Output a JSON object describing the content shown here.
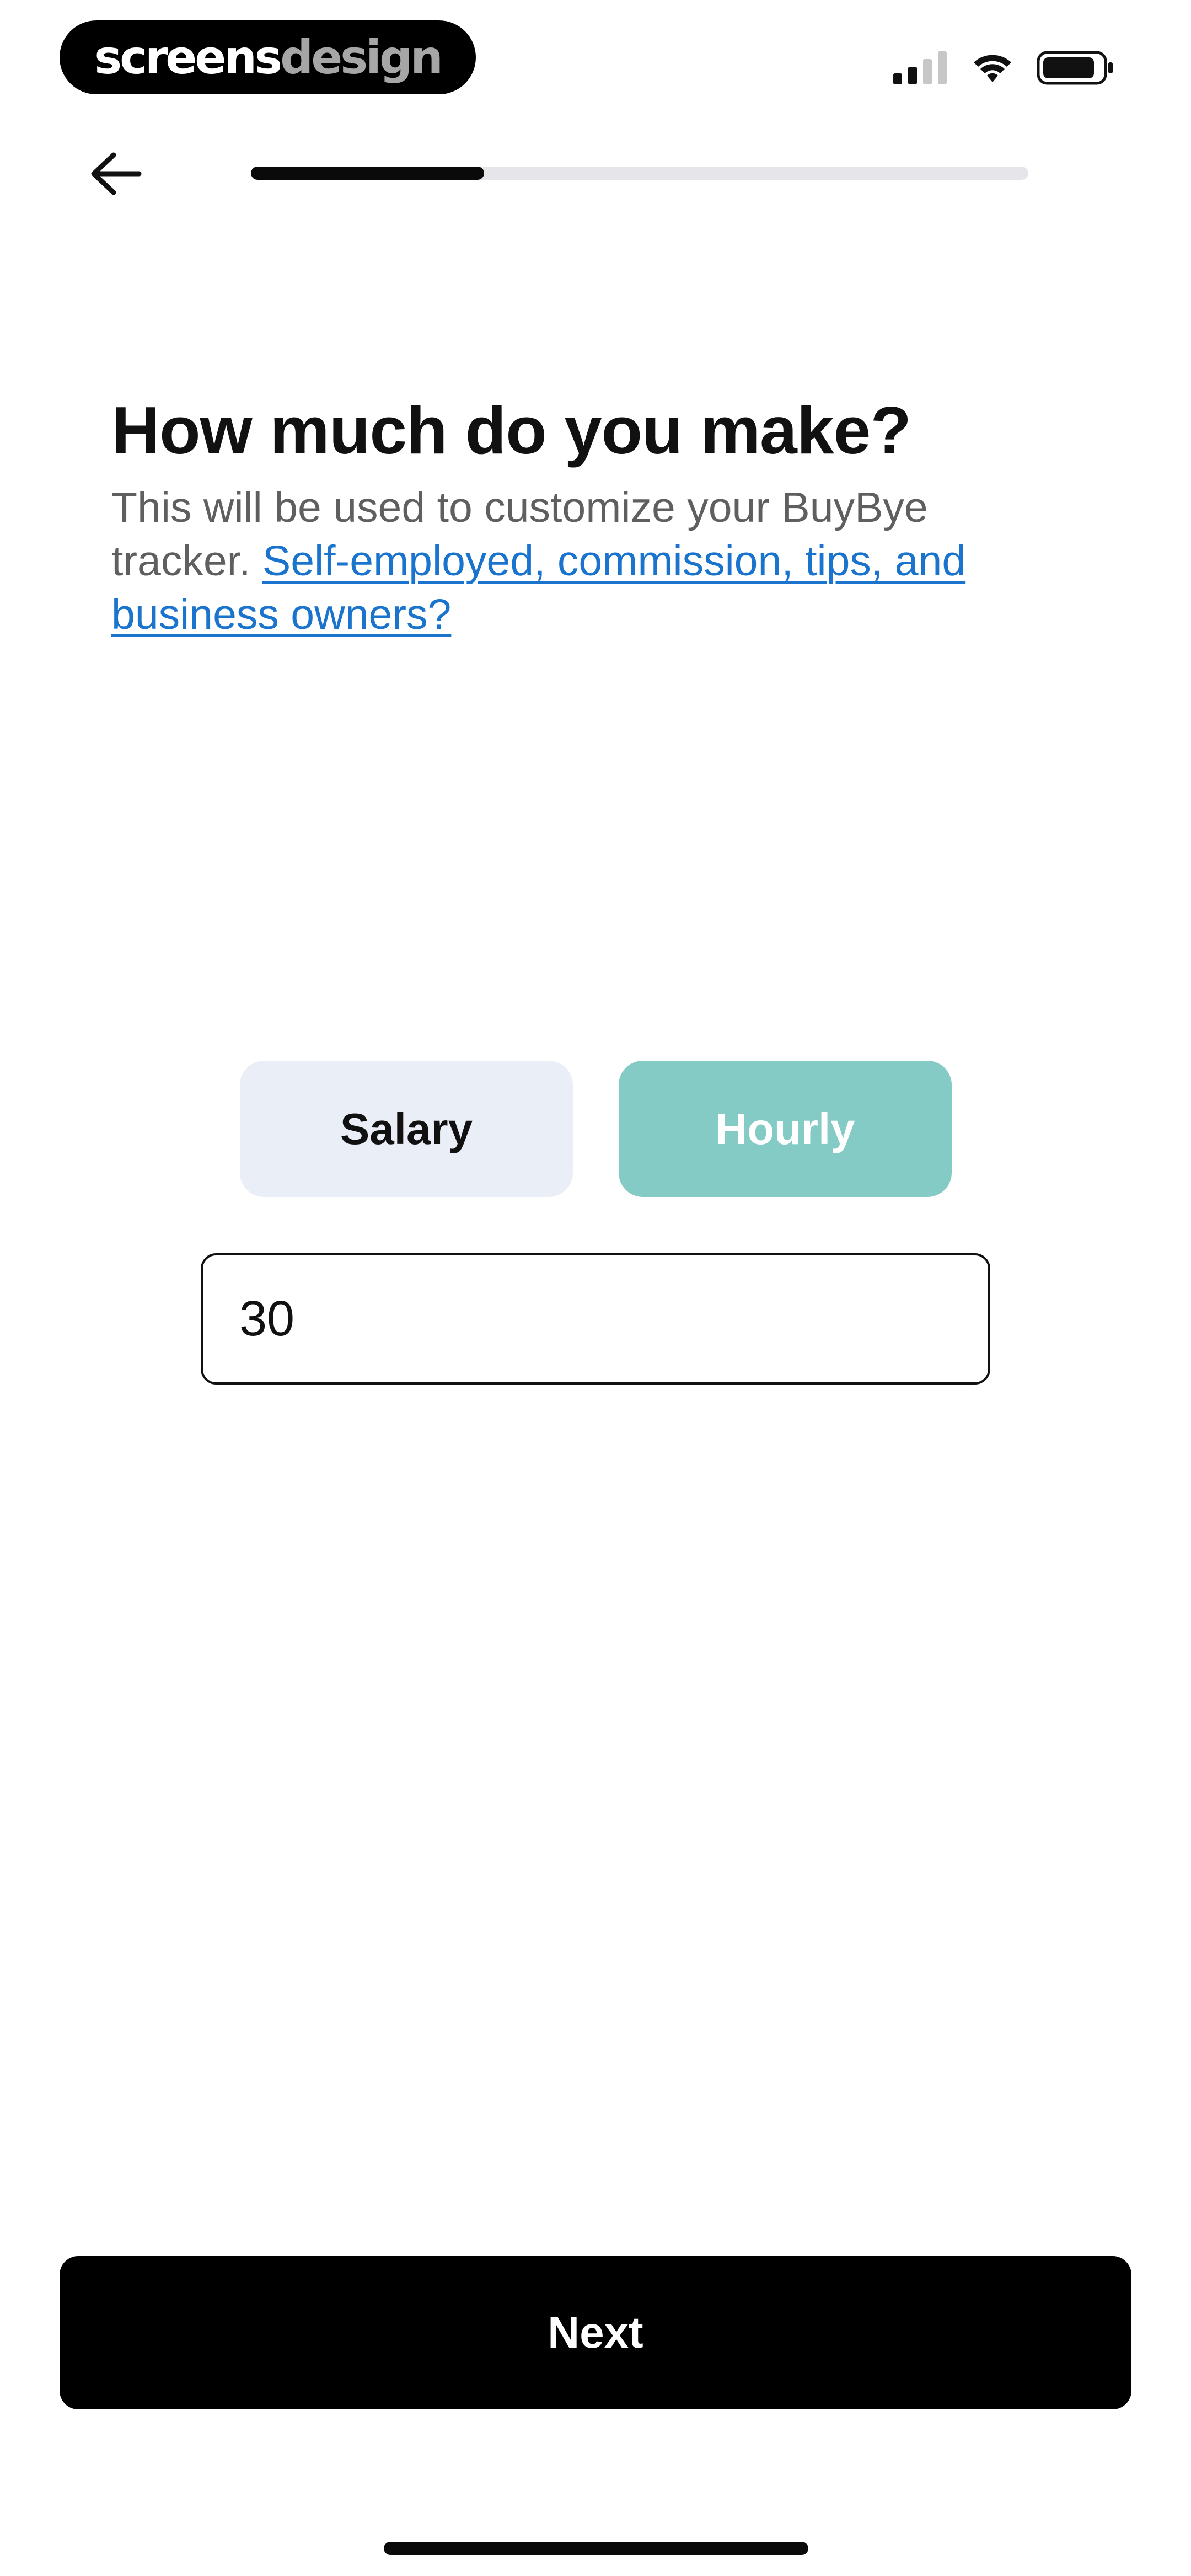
{
  "status_bar": {
    "brand_part1": "screens",
    "brand_part2": "design",
    "icons": [
      "cellular-signal-icon",
      "wifi-icon",
      "battery-icon"
    ]
  },
  "nav": {
    "back_icon": "arrow-left-icon",
    "progress": 0.3
  },
  "page": {
    "title": "How much do you make?",
    "subtitle": "This will be used to customize your BuyBye tracker.",
    "link_text": "Self-employed, commission, tips, and business owners?"
  },
  "pay_type": {
    "options": [
      "Salary",
      "Hourly"
    ],
    "selected": "Hourly"
  },
  "amount_input": {
    "value": "30"
  },
  "footer": {
    "next_label": "Next"
  },
  "colors": {
    "accent_teal": "#84cbc5",
    "unselected_option": "#eaeef7",
    "link_blue": "#1a73cc",
    "primary_button": "#000000"
  }
}
